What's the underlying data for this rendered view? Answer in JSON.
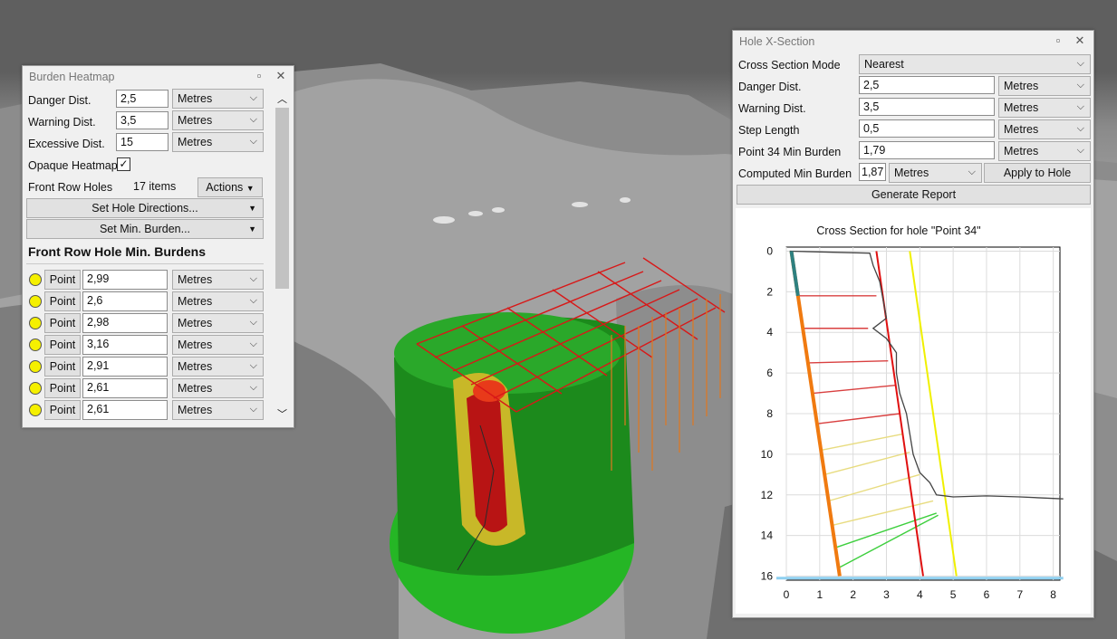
{
  "burden_heatmap": {
    "title": "Burden Heatmap",
    "danger": {
      "label": "Danger Dist.",
      "value": "2,5",
      "unit": "Metres"
    },
    "warning": {
      "label": "Warning Dist.",
      "value": "3,5",
      "unit": "Metres"
    },
    "excessive": {
      "label": "Excessive Dist.",
      "value": "15",
      "unit": "Metres"
    },
    "opaque_label": "Opaque Heatmap",
    "front_row_label": "Front Row Holes",
    "front_row_count": "17 items",
    "actions_label": "Actions",
    "set_directions_label": "Set Hole Directions...",
    "set_min_burden_label": "Set Min. Burden...",
    "section_header": "Front Row Hole Min. Burdens",
    "rows": [
      {
        "button": "Point",
        "value": "2,99",
        "unit": "Metres"
      },
      {
        "button": "Point",
        "value": "2,6",
        "unit": "Metres"
      },
      {
        "button": "Point",
        "value": "2,98",
        "unit": "Metres"
      },
      {
        "button": "Point",
        "value": "3,16",
        "unit": "Metres"
      },
      {
        "button": "Point",
        "value": "2,91",
        "unit": "Metres"
      },
      {
        "button": "Point",
        "value": "2,61",
        "unit": "Metres"
      },
      {
        "button": "Point",
        "value": "2,61",
        "unit": "Metres"
      }
    ],
    "indicator_color": "#f5f000"
  },
  "hole_xsection": {
    "title": "Hole X-Section",
    "mode": {
      "label": "Cross Section Mode",
      "value": "Nearest"
    },
    "danger": {
      "label": "Danger Dist.",
      "value": "2,5",
      "unit": "Metres"
    },
    "warning": {
      "label": "Warning Dist.",
      "value": "3,5",
      "unit": "Metres"
    },
    "step": {
      "label": "Step Length",
      "value": "0,5",
      "unit": "Metres"
    },
    "point_min": {
      "label": "Point 34 Min Burden",
      "value": "1,79",
      "unit": "Metres"
    },
    "computed": {
      "label": "Computed Min Burden",
      "value": "1,87",
      "unit": "Metres"
    },
    "apply_label": "Apply to Hole",
    "generate_label": "Generate Report"
  },
  "chart_data": {
    "type": "line",
    "title": "Cross Section for hole \"Point 34\"",
    "xlim": [
      0,
      8.2
    ],
    "ylim": [
      16.2,
      -0.2
    ],
    "x_ticks": [
      0,
      1,
      2,
      3,
      4,
      5,
      6,
      7,
      8
    ],
    "y_ticks": [
      0,
      2,
      4,
      6,
      8,
      10,
      12,
      14,
      16
    ],
    "grid": true,
    "series": [
      {
        "role": "hole",
        "color": "#f07a10",
        "points": [
          [
            0.15,
            0
          ],
          [
            1.6,
            16
          ]
        ]
      },
      {
        "role": "danger-line",
        "color": "#e01010",
        "points": [
          [
            2.7,
            0
          ],
          [
            4.1,
            16
          ]
        ]
      },
      {
        "role": "warning-line",
        "color": "#f0f000",
        "points": [
          [
            3.7,
            0
          ],
          [
            5.1,
            16
          ]
        ]
      },
      {
        "role": "face-profile",
        "color": "#444444",
        "points": [
          [
            0.1,
            0
          ],
          [
            2.5,
            0.1
          ],
          [
            2.6,
            0.7
          ],
          [
            2.8,
            1.5
          ],
          [
            2.9,
            2.4
          ],
          [
            3,
            3.3
          ],
          [
            2.6,
            3.8
          ],
          [
            3,
            4.3
          ],
          [
            3.3,
            5
          ],
          [
            3.3,
            6
          ],
          [
            3.4,
            7
          ],
          [
            3.6,
            8
          ],
          [
            3.7,
            9
          ],
          [
            3.8,
            10
          ],
          [
            4,
            10.9
          ],
          [
            4.3,
            11.4
          ],
          [
            4.5,
            12
          ],
          [
            5,
            12.1
          ],
          [
            6,
            12.05
          ],
          [
            7,
            12.1
          ],
          [
            8.3,
            12.2
          ]
        ]
      },
      {
        "role": "floor",
        "color": "#8fd0f0",
        "points": [
          [
            -0.3,
            16.1
          ],
          [
            8.3,
            16.1
          ]
        ]
      }
    ],
    "burden_segments": [
      {
        "y0": 2.2,
        "x1": 2.7,
        "y1": 2.2,
        "color": "red"
      },
      {
        "y0": 3.8,
        "x1": 2.45,
        "y1": 3.8,
        "color": "red"
      },
      {
        "y0": 5.5,
        "x1": 3.05,
        "y1": 5.4,
        "color": "red"
      },
      {
        "y0": 7.0,
        "x1": 3.3,
        "y1": 6.6,
        "color": "red"
      },
      {
        "y0": 8.5,
        "x1": 3.4,
        "y1": 8.0,
        "color": "red"
      },
      {
        "y0": 9.8,
        "x1": 3.5,
        "y1": 9.0,
        "color": "yellow"
      },
      {
        "y0": 11.0,
        "x1": 3.7,
        "y1": 9.9,
        "color": "yellow"
      },
      {
        "y0": 12.3,
        "x1": 4.0,
        "y1": 11.0,
        "color": "yellow"
      },
      {
        "y0": 13.5,
        "x1": 4.4,
        "y1": 12.3,
        "color": "yellow"
      },
      {
        "y0": 14.6,
        "x1": 4.5,
        "y1": 12.9,
        "color": "green"
      },
      {
        "y0": 15.6,
        "x1": 4.55,
        "y1": 13.0,
        "color": "green"
      }
    ]
  }
}
